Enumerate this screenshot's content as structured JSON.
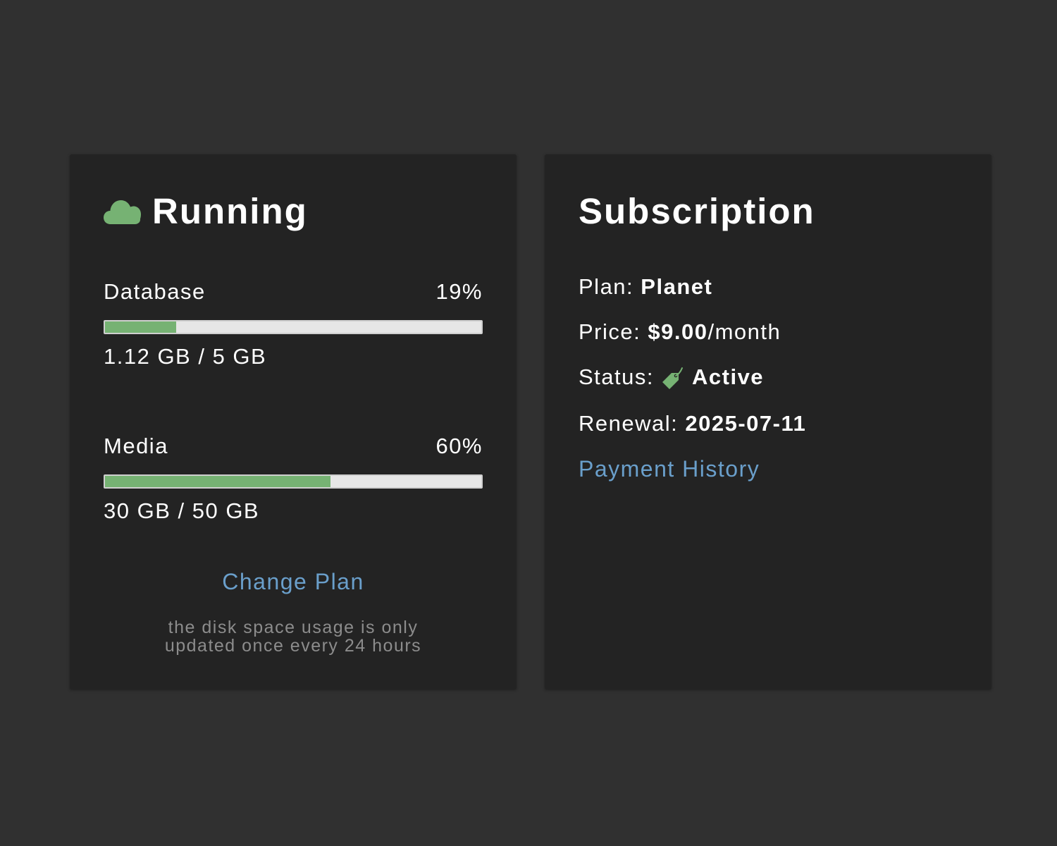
{
  "status_card": {
    "title": "Running",
    "title_icon": "cloud-icon",
    "database": {
      "label": "Database",
      "percent_text": "19%",
      "percent": 19,
      "usage_text": "1.12 GB / 5 GB"
    },
    "media": {
      "label": "Media",
      "percent_text": "60%",
      "percent": 60,
      "usage_text": "30 GB / 50 GB"
    },
    "change_plan_label": "Change Plan",
    "note_line1": "the disk space usage is only",
    "note_line2": "updated once every 24 hours"
  },
  "subscription_card": {
    "title": "Subscription",
    "plan_label": "Plan:",
    "plan_value": "Planet",
    "price_label": "Price:",
    "price_value": "$9.00",
    "price_suffix": "/month",
    "status_label": "Status:",
    "status_icon": "tag-icon",
    "status_value": "Active",
    "renewal_label": "Renewal:",
    "renewal_value": "2025-07-11",
    "payment_history_label": "Payment History"
  },
  "colors": {
    "page_background": "#303030",
    "card_background": "#232323",
    "accent_green": "#76b273",
    "link_blue": "#6a9fcb",
    "note_gray": "#8c8c8c"
  }
}
